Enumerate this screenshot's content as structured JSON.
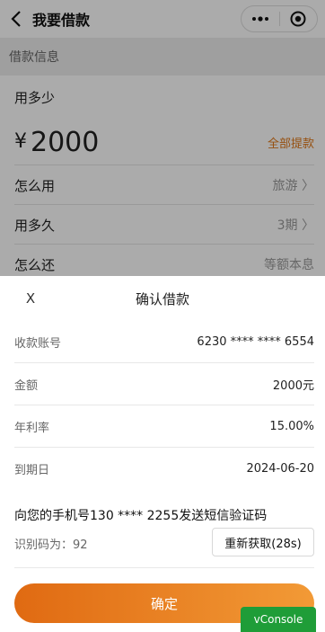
{
  "header": {
    "title": "我要借款",
    "back_icon": "chevron-left-icon",
    "more_icon": "more-dots-icon",
    "target_icon": "target-icon"
  },
  "section": {
    "title": "借款信息"
  },
  "loan": {
    "how_much_label": "用多少",
    "currency": "¥",
    "amount": "2000",
    "withdraw_all": "全部提款",
    "options": [
      {
        "label": "怎么用",
        "value": "旅游 〉"
      },
      {
        "label": "用多久",
        "value": "3期 〉"
      },
      {
        "label": "怎么还",
        "value": "等额本息"
      }
    ]
  },
  "dialog": {
    "close_label": "X",
    "title": "确认借款",
    "rows": [
      {
        "label": "收款账号",
        "value": "6230 **** **** 6554"
      },
      {
        "label": "金额",
        "value": "2000元"
      },
      {
        "label": "年利率",
        "value": "15.00%"
      },
      {
        "label": "到期日",
        "value": "2024-06-20"
      }
    ],
    "sms_text": "向您的手机号130 **** 2255发送短信验证码",
    "ident_code": "识别码为：92",
    "resend_label": "重新获取(28s)",
    "confirm_label": "确定"
  },
  "vconsole": {
    "label": "vConsole"
  },
  "colors": {
    "accent": "#e07818",
    "button_start": "#e06a12",
    "button_end": "#f29a36",
    "vconsole": "#1f9d38"
  }
}
